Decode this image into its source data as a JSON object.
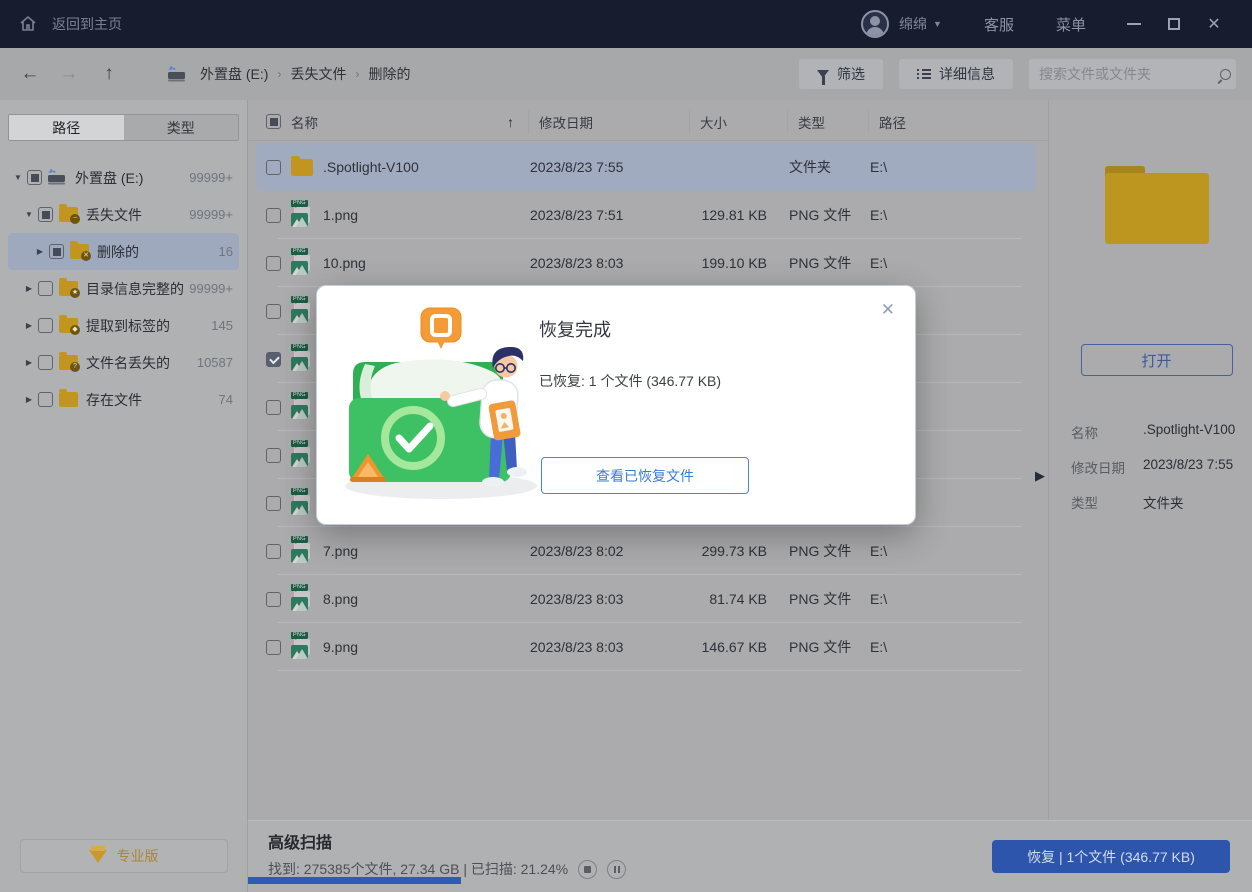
{
  "titlebar": {
    "back_home": "返回到主页",
    "username": "绵绵",
    "support": "客服",
    "menu": "菜单"
  },
  "toolbar": {
    "breadcrumbs": [
      "外置盘 (E:)",
      "丢失文件",
      "删除的"
    ],
    "filter_label": "筛选",
    "details_label": "详细信息",
    "search_placeholder": "搜索文件或文件夹"
  },
  "sidebar": {
    "tabs": [
      {
        "label": "路径",
        "active": true
      },
      {
        "label": "类型",
        "active": false
      }
    ],
    "tree": [
      {
        "label": "外置盘 (E:)",
        "count": "99999+",
        "level": 0,
        "caret": "down",
        "check": "ind",
        "icon": "drive",
        "selected": false
      },
      {
        "label": "丢失文件",
        "count": "99999+",
        "level": 1,
        "caret": "down",
        "check": "ind",
        "icon": "folder",
        "badge": "−",
        "selected": false
      },
      {
        "label": "删除的",
        "count": "16",
        "level": 2,
        "caret": "right",
        "check": "ind",
        "icon": "folder",
        "badge": "✕",
        "selected": true
      },
      {
        "label": "目录信息完整的",
        "count": "99999+",
        "level": 1,
        "caret": "right",
        "check": "none",
        "icon": "folder",
        "badge": "★",
        "selected": false
      },
      {
        "label": "提取到标签的",
        "count": "145",
        "level": 1,
        "caret": "right",
        "check": "none",
        "icon": "folder",
        "badge": "◆",
        "selected": false
      },
      {
        "label": "文件名丢失的",
        "count": "10587",
        "level": 1,
        "caret": "right",
        "check": "none",
        "icon": "folder",
        "badge": "?",
        "selected": false
      },
      {
        "label": "存在文件",
        "count": "74",
        "level": 1,
        "caret": "right",
        "check": "none",
        "icon": "folder",
        "badge": "",
        "selected": false
      }
    ],
    "pro_button": "专业版"
  },
  "table": {
    "columns": [
      "名称",
      "修改日期",
      "大小",
      "类型",
      "路径"
    ],
    "rows": [
      {
        "name": ".Spotlight-V100",
        "date": "2023/8/23 7:55",
        "size": "",
        "type": "文件夹",
        "path": "E:\\",
        "icon": "folder",
        "checked": false,
        "selected": true
      },
      {
        "name": "1.png",
        "date": "2023/8/23 7:51",
        "size": "129.81 KB",
        "type": "PNG 文件",
        "path": "E:\\",
        "icon": "png",
        "checked": false,
        "selected": false
      },
      {
        "name": "10.png",
        "date": "2023/8/23 8:03",
        "size": "199.10 KB",
        "type": "PNG 文件",
        "path": "E:\\",
        "icon": "png",
        "checked": false,
        "selected": false
      },
      {
        "name": "",
        "date": "",
        "size": "",
        "type": "",
        "path": "",
        "icon": "png",
        "checked": false,
        "selected": false
      },
      {
        "name": "",
        "date": "",
        "size": "",
        "type": "",
        "path": "",
        "icon": "png",
        "checked": true,
        "selected": false
      },
      {
        "name": "",
        "date": "",
        "size": "",
        "type": "",
        "path": "",
        "icon": "png",
        "checked": false,
        "selected": false
      },
      {
        "name": "",
        "date": "",
        "size": "",
        "type": "",
        "path": "",
        "icon": "png",
        "checked": false,
        "selected": false
      },
      {
        "name": "",
        "date": "",
        "size": "",
        "type": "",
        "path": "",
        "icon": "png",
        "checked": false,
        "selected": false
      },
      {
        "name": "7.png",
        "date": "2023/8/23 8:02",
        "size": "299.73 KB",
        "type": "PNG 文件",
        "path": "E:\\",
        "icon": "png",
        "checked": false,
        "selected": false
      },
      {
        "name": "8.png",
        "date": "2023/8/23 8:03",
        "size": "81.74 KB",
        "type": "PNG 文件",
        "path": "E:\\",
        "icon": "png",
        "checked": false,
        "selected": false
      },
      {
        "name": "9.png",
        "date": "2023/8/23 8:03",
        "size": "146.67 KB",
        "type": "PNG 文件",
        "path": "E:\\",
        "icon": "png",
        "checked": false,
        "selected": false
      }
    ]
  },
  "preview": {
    "open_button": "打开",
    "details": [
      {
        "label": "名称",
        "value": ".Spotlight-V100"
      },
      {
        "label": "修改日期",
        "value": "2023/8/23 7:55"
      },
      {
        "label": "类型",
        "value": "文件夹"
      }
    ]
  },
  "dialog": {
    "title": "恢复完成",
    "message": "已恢复: 1 个文件 (346.77 KB)",
    "action": "查看已恢复文件"
  },
  "footer": {
    "scan_title": "高级扫描",
    "scan_status": "找到: 275385个文件, 27.34 GB | 已扫描: 21.24%",
    "scan_percent": "21.24%",
    "recover_button": "恢复 | 1个文件 (346.77 KB)"
  },
  "colors": {
    "accent_blue": "#2d55ab",
    "titlebar_bg": "#171c2e",
    "folder_gold": "#c1951f",
    "success_green": "#3ec164"
  }
}
